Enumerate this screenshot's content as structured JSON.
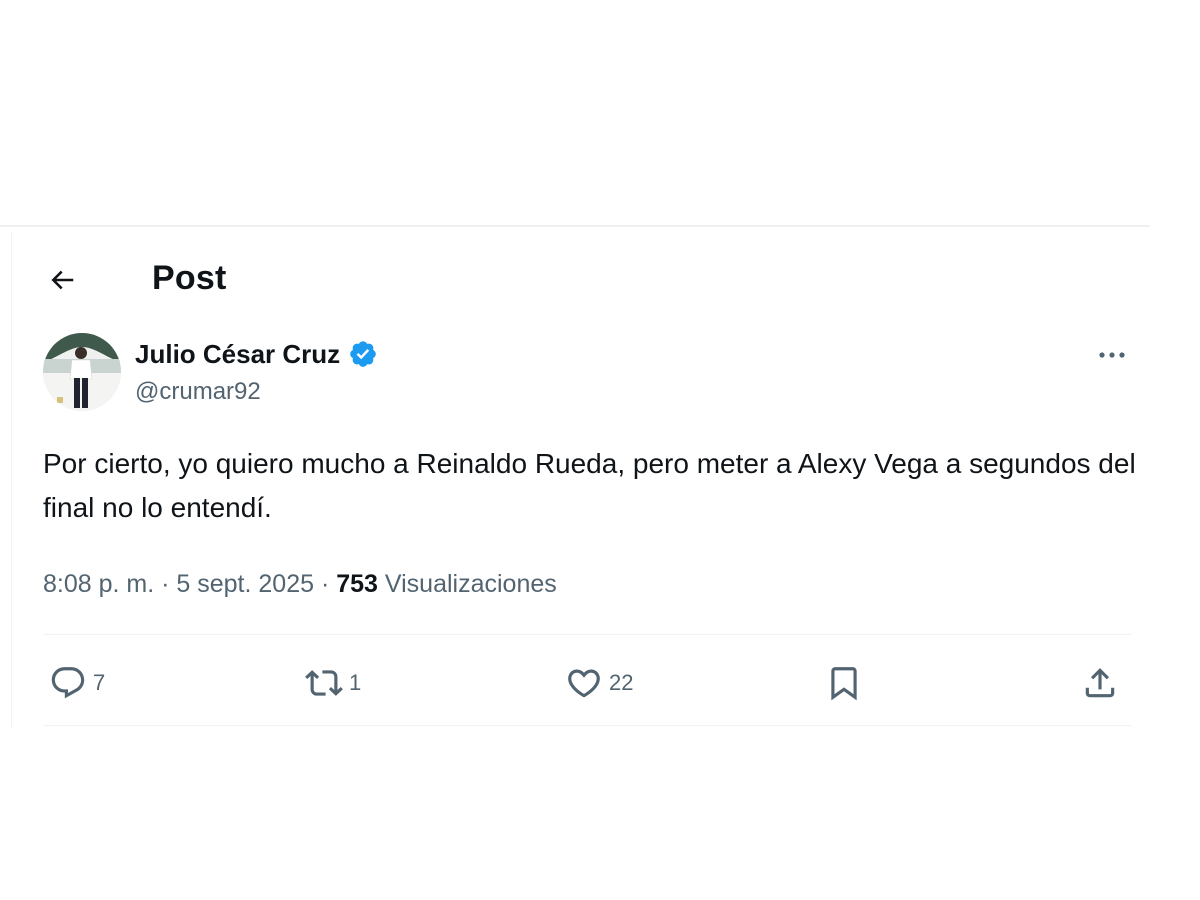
{
  "header": {
    "title": "Post"
  },
  "author": {
    "display_name": "Julio César Cruz",
    "handle": "@crumar92",
    "verified_color": "#1d9bf0"
  },
  "post": {
    "text": "Por cierto, yo quiero mucho a Reinaldo Rueda, pero meter a Alexy Vega a segundos del final no lo entendí.",
    "time": "8:08 p. m.",
    "separator": " · ",
    "date": "5 sept. 2025",
    "views_count": "753",
    "views_label": "Visualizaciones"
  },
  "actions": {
    "replies": "7",
    "reposts": "1",
    "likes": "22"
  },
  "icons": {
    "back": "arrow-left-icon",
    "verified": "verified-badge-icon",
    "more": "more-dots-icon",
    "reply": "reply-bubble-icon",
    "repost": "repost-icon",
    "like": "heart-icon",
    "bookmark": "bookmark-icon",
    "share": "share-upload-icon"
  },
  "colors": {
    "text_primary": "#0f1419",
    "text_secondary": "#536471",
    "accent": "#1d9bf0"
  }
}
